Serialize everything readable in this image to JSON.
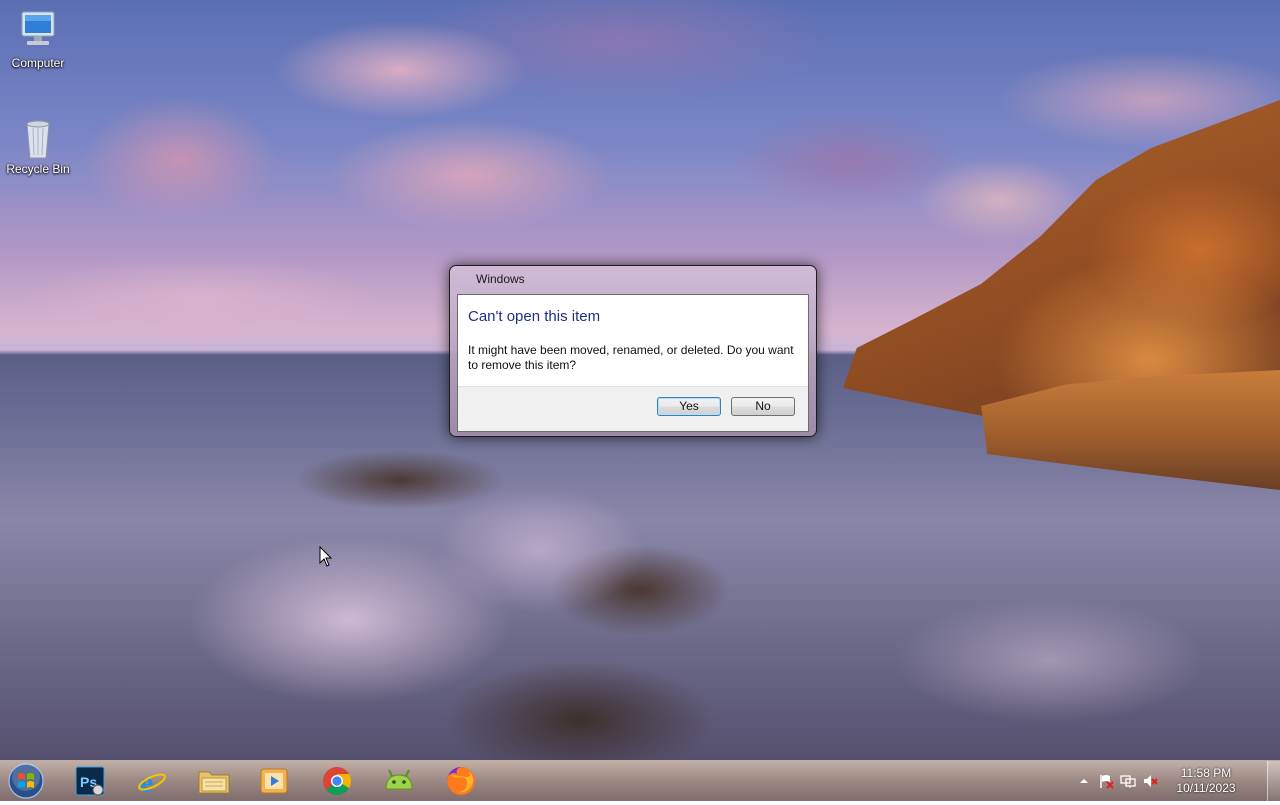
{
  "desktop": {
    "icons": [
      {
        "label": "Computer",
        "icon": "computer-icon"
      },
      {
        "label": "Recycle Bin",
        "icon": "recycle-bin-icon"
      }
    ]
  },
  "dialog": {
    "window_title": "Windows",
    "heading": "Can't open this item",
    "message": "It might have been moved, renamed, or deleted. Do you want to remove this item?",
    "yes_label": "Yes",
    "no_label": "No"
  },
  "taskbar": {
    "apps": [
      {
        "name": "photoshop",
        "icon": "photoshop-icon"
      },
      {
        "name": "internet-explorer",
        "icon": "internet-explorer-icon"
      },
      {
        "name": "file-explorer",
        "icon": "folder-icon"
      },
      {
        "name": "media-player",
        "icon": "media-player-icon"
      },
      {
        "name": "chrome",
        "icon": "chrome-icon"
      },
      {
        "name": "android-app",
        "icon": "android-icon"
      },
      {
        "name": "firefox",
        "icon": "firefox-icon"
      }
    ],
    "tray": {
      "time": "11:58 PM",
      "date": "10/11/2023",
      "icons": [
        "show-hidden-icons-arrow",
        "action-center-flag-icon",
        "network-icon",
        "volume-muted-icon"
      ]
    }
  },
  "colors": {
    "dialog_heading": "#1e3287",
    "default_button_border": "#3c7fb1"
  }
}
